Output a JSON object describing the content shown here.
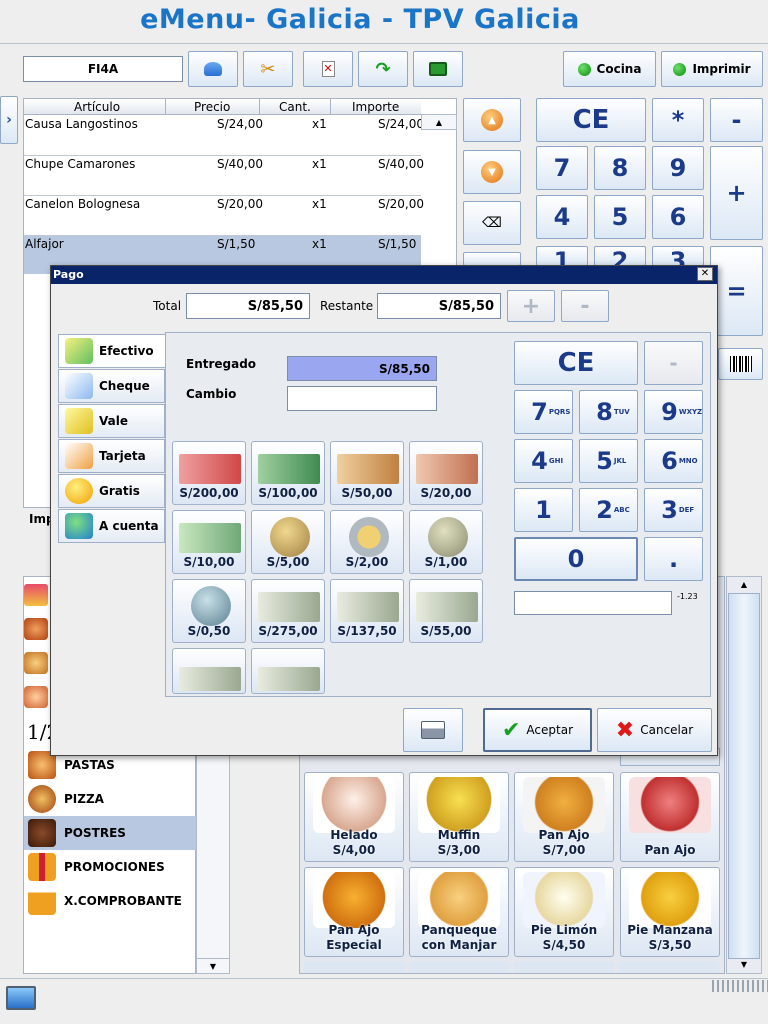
{
  "app": {
    "title": "eMenu- Galicia - TPV Galicia"
  },
  "toolbar": {
    "table_code": "FI4A",
    "kitchen_label": "Cocina",
    "print_label": "Imprimir"
  },
  "order": {
    "columns": [
      "Artículo",
      "Precio",
      "Cant.",
      "Importe"
    ],
    "rows": [
      {
        "item": "Causa Langostinos",
        "price": "S/24,00",
        "qty": "x1",
        "amount": "S/24,00"
      },
      {
        "item": "Chupe Camarones",
        "price": "S/40,00",
        "qty": "x1",
        "amount": "S/40,00"
      },
      {
        "item": "Canelon Bolognesa",
        "price": "S/20,00",
        "qty": "x1",
        "amount": "S/20,00"
      },
      {
        "item": "Alfajor",
        "price": "S/1,50",
        "qty": "x1",
        "amount": "S/1,50"
      }
    ],
    "partial_label": "Imp"
  },
  "keypad": {
    "ce": "CE",
    "mult": "*",
    "minus": "-",
    "plus": "+",
    "equals": "=",
    "digits": [
      "7",
      "8",
      "9",
      "4",
      "5",
      "6",
      "1",
      "2",
      "3"
    ]
  },
  "categories": {
    "partial_fraction": "1/2",
    "items": [
      {
        "label": "PASTAS"
      },
      {
        "label": "PIZZA"
      },
      {
        "label": "POSTRES"
      },
      {
        "label": "PROMOCIONES"
      },
      {
        "label": "X.COMPROBANTE"
      }
    ]
  },
  "products": [
    {
      "name": "Helado",
      "price": "S/4,00"
    },
    {
      "name": "Muffin",
      "price": "S/3,00"
    },
    {
      "name": "Pan Ajo",
      "price": "S/7,00"
    },
    {
      "name": "Pan Ajo",
      "price": ""
    },
    {
      "name": "Pan Ajo Especial",
      "price": ""
    },
    {
      "name": "Panqueque con Manjar",
      "price": ""
    },
    {
      "name": "Pie Limón",
      "price": "S/4,50"
    },
    {
      "name": "Pie Manzana",
      "price": "S/3,50"
    }
  ],
  "payment": {
    "title": "Pago",
    "total_label": "Total",
    "total_value": "S/85,50",
    "remaining_label": "Restante",
    "remaining_value": "S/85,50",
    "plus": "+",
    "minus": "-",
    "tabs": [
      {
        "label": "Efectivo"
      },
      {
        "label": "Cheque"
      },
      {
        "label": "Vale"
      },
      {
        "label": "Tarjeta"
      },
      {
        "label": "Gratis"
      },
      {
        "label": "A cuenta"
      }
    ],
    "delivered_label": "Entregado",
    "delivered_value": "S/85,50",
    "change_label": "Cambio",
    "change_value": "",
    "denominations": [
      "S/200,00",
      "S/100,00",
      "S/50,00",
      "S/20,00",
      "S/10,00",
      "S/5,00",
      "S/2,00",
      "S/1,00",
      "S/0,50",
      "S/275,00",
      "S/137,50",
      "S/55,00",
      "",
      ""
    ],
    "keypad": {
      "ce": "CE",
      "minus": "-",
      "zero": "0",
      "dot": ".",
      "keys": [
        {
          "d": "7",
          "s": "PQRS"
        },
        {
          "d": "8",
          "s": "TUV"
        },
        {
          "d": "9",
          "s": "WXYZ"
        },
        {
          "d": "4",
          "s": "GHI"
        },
        {
          "d": "5",
          "s": "JKL"
        },
        {
          "d": "6",
          "s": "MNO"
        },
        {
          "d": "1",
          "s": ""
        },
        {
          "d": "2",
          "s": "ABC"
        },
        {
          "d": "3",
          "s": "DEF"
        }
      ]
    },
    "side_value": "-1.23",
    "accept_label": "Aceptar",
    "cancel_label": "Cancelar"
  }
}
